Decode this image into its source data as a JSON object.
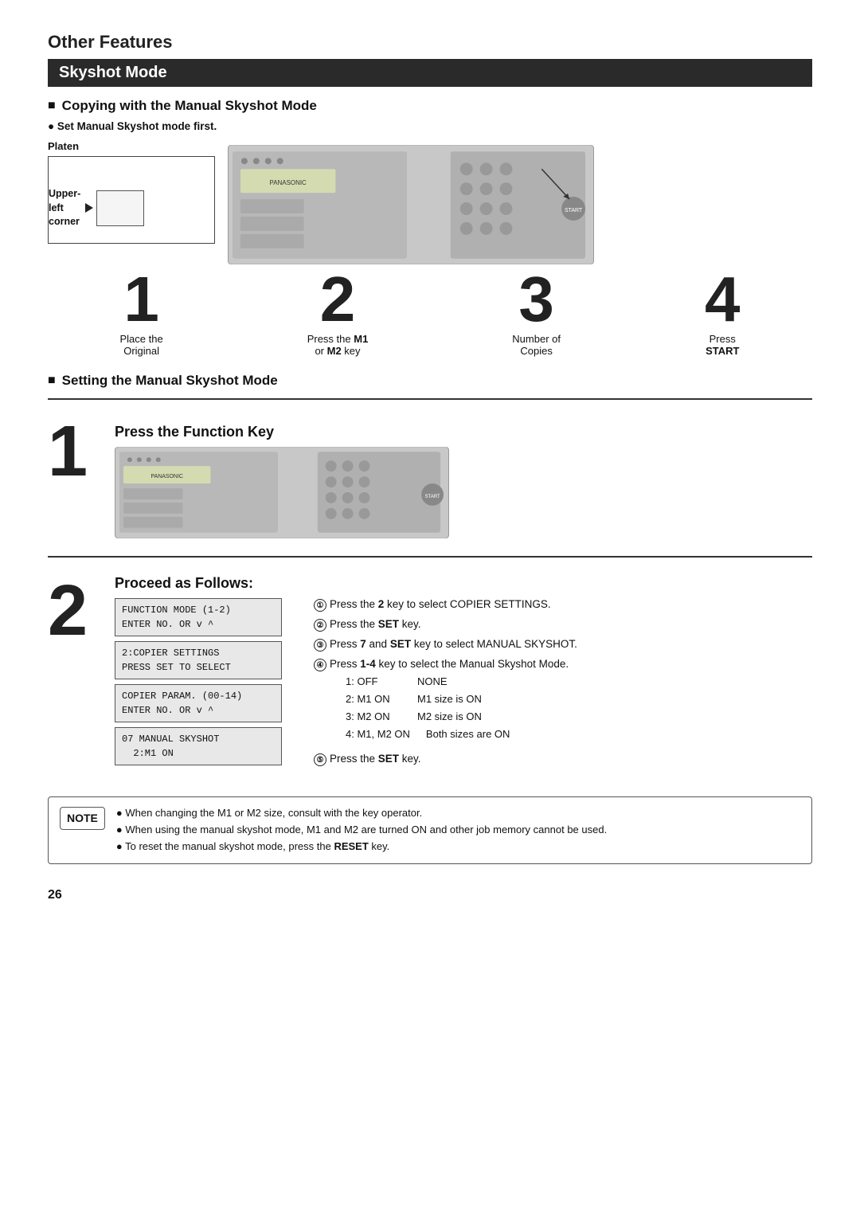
{
  "page": {
    "title": "Other Features",
    "section": "Skyshot Mode",
    "page_number": "26"
  },
  "copying_section": {
    "title": "Copying with the Manual Skyshot Mode",
    "bullet": "Set Manual Skyshot mode first.",
    "platen_label": "Platen",
    "upper_left_label": "Upper-\nleft\ncorner",
    "steps": [
      {
        "number": "1",
        "lines": [
          "Place the",
          "Original"
        ]
      },
      {
        "number": "2",
        "lines": [
          "Press the ",
          "M1",
          " or ",
          "M2",
          " key"
        ]
      },
      {
        "number": "3",
        "lines": [
          "Number of",
          "Copies"
        ]
      },
      {
        "number": "4",
        "lines": [
          "Press",
          "START"
        ]
      }
    ]
  },
  "setting_section": {
    "title": "Setting the Manual Skyshot Mode",
    "step1_num": "1",
    "press_function_key": "Press the Function Key",
    "step2_num": "2",
    "proceed_label": "Proceed as Follows:",
    "lcd_screens": [
      "FUNCTION MODE  (1-2)\nENTER NO. OR v ^",
      "2:COPIER SETTINGS\nPRESS SET TO SELECT",
      "COPIER PARAM. (00-14)\nENTER NO. OR v ^",
      "07 MANUAL SKYSHOT\n  2:M1 ON"
    ],
    "instructions": [
      {
        "num": "①",
        "text": "Press the ",
        "bold": "2",
        "rest": " key to select COPIER SETTINGS."
      },
      {
        "num": "②",
        "text": "Press the ",
        "bold": "SET",
        "rest": " key."
      },
      {
        "num": "③",
        "text": "Press ",
        "bold": "7",
        "rest": " and ",
        "bold2": "SET",
        "rest2": " key to select MANUAL SKYSHOT."
      },
      {
        "num": "④",
        "text": "Press ",
        "bold": "1-4",
        "rest": " key to select the Manual Skyshot Mode."
      }
    ],
    "modes": [
      {
        "key": "1: OFF",
        "val": "NONE"
      },
      {
        "key": "2: M1 ON",
        "val": "M1 size is ON"
      },
      {
        "key": "3: M2 ON",
        "val": "M2 size is ON"
      },
      {
        "key": "4: M1, M2 ON",
        "val": "Both sizes are ON"
      }
    ],
    "instruction5": {
      "num": "⑤",
      "text": "Press the ",
      "bold": "SET",
      "rest": " key."
    }
  },
  "note": {
    "label": "NOTE",
    "items": [
      "When changing the M1 or M2 size, consult with the key operator.",
      "When using the manual skyshot mode, M1 and M2 are turned ON and other job memory cannot be used.",
      "To reset the manual skyshot mode, press the RESET key."
    ],
    "reset_bold": "RESET"
  }
}
